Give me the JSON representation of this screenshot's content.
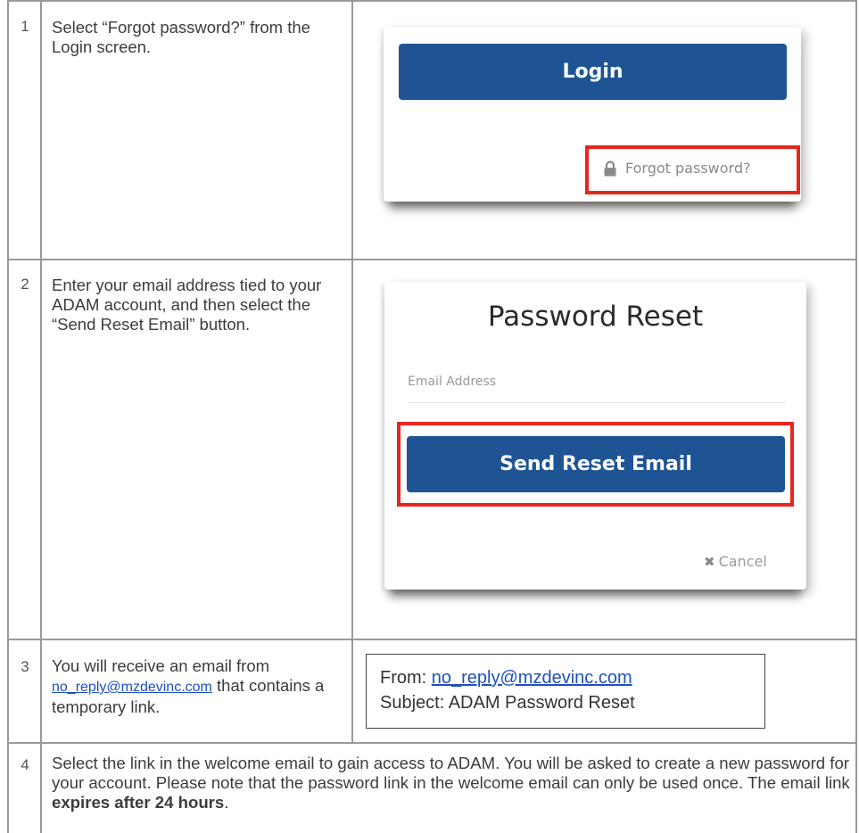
{
  "steps": [
    {
      "number": "1",
      "text": "Select “Forgot password?” from the Login screen.",
      "screenshot": {
        "login_button": "Login",
        "forgot_link": "Forgot password?",
        "icon": "lock-icon"
      }
    },
    {
      "number": "2",
      "text": "Enter your email address tied to your ADAM account, and then select the “Send Reset Email” button.",
      "screenshot": {
        "title": "Password Reset",
        "email_placeholder": "Email Address",
        "send_button": "Send Reset Email",
        "cancel": "Cancel",
        "icon": "close-icon"
      }
    },
    {
      "number": "3",
      "text_before": "You will receive an email from",
      "email_link": "no_reply@mzdevinc.com",
      "text_after": "that contains a temporary link.",
      "email": {
        "from_label": "From:",
        "from_address": "no_reply@mzdevinc.com",
        "subject": "Subject: ADAM Password Reset"
      }
    },
    {
      "number": "4",
      "text_before": "Select the link in the welcome email to gain access to ADAM. You will be asked to create a new password for your account. Please note that the password link in the welcome email can only be used once. The email link",
      "text_bold": "expires after 24 hours",
      "text_after": "."
    }
  ],
  "colors": {
    "button_blue": "#1e5493",
    "highlight_red": "#e6261f",
    "link_blue": "#1f4fbf"
  }
}
